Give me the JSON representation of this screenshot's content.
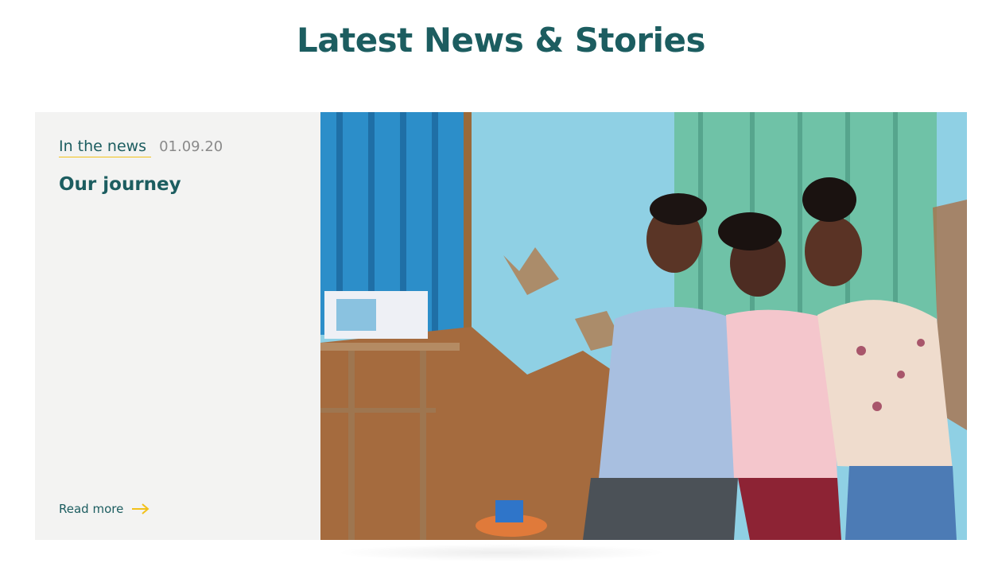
{
  "section": {
    "heading": "Latest News & Stories"
  },
  "card": {
    "category": "In the news",
    "date": "01.09.20",
    "title": "Our journey",
    "read_more": "Read more",
    "arrow_icon": "arrow-right-icon",
    "image": "photo-three-women-smiling"
  },
  "colors": {
    "brand": "#1c5d60",
    "accent": "#f2c11a",
    "card_bg": "#f3f3f2",
    "date": "#8a8a8a"
  }
}
